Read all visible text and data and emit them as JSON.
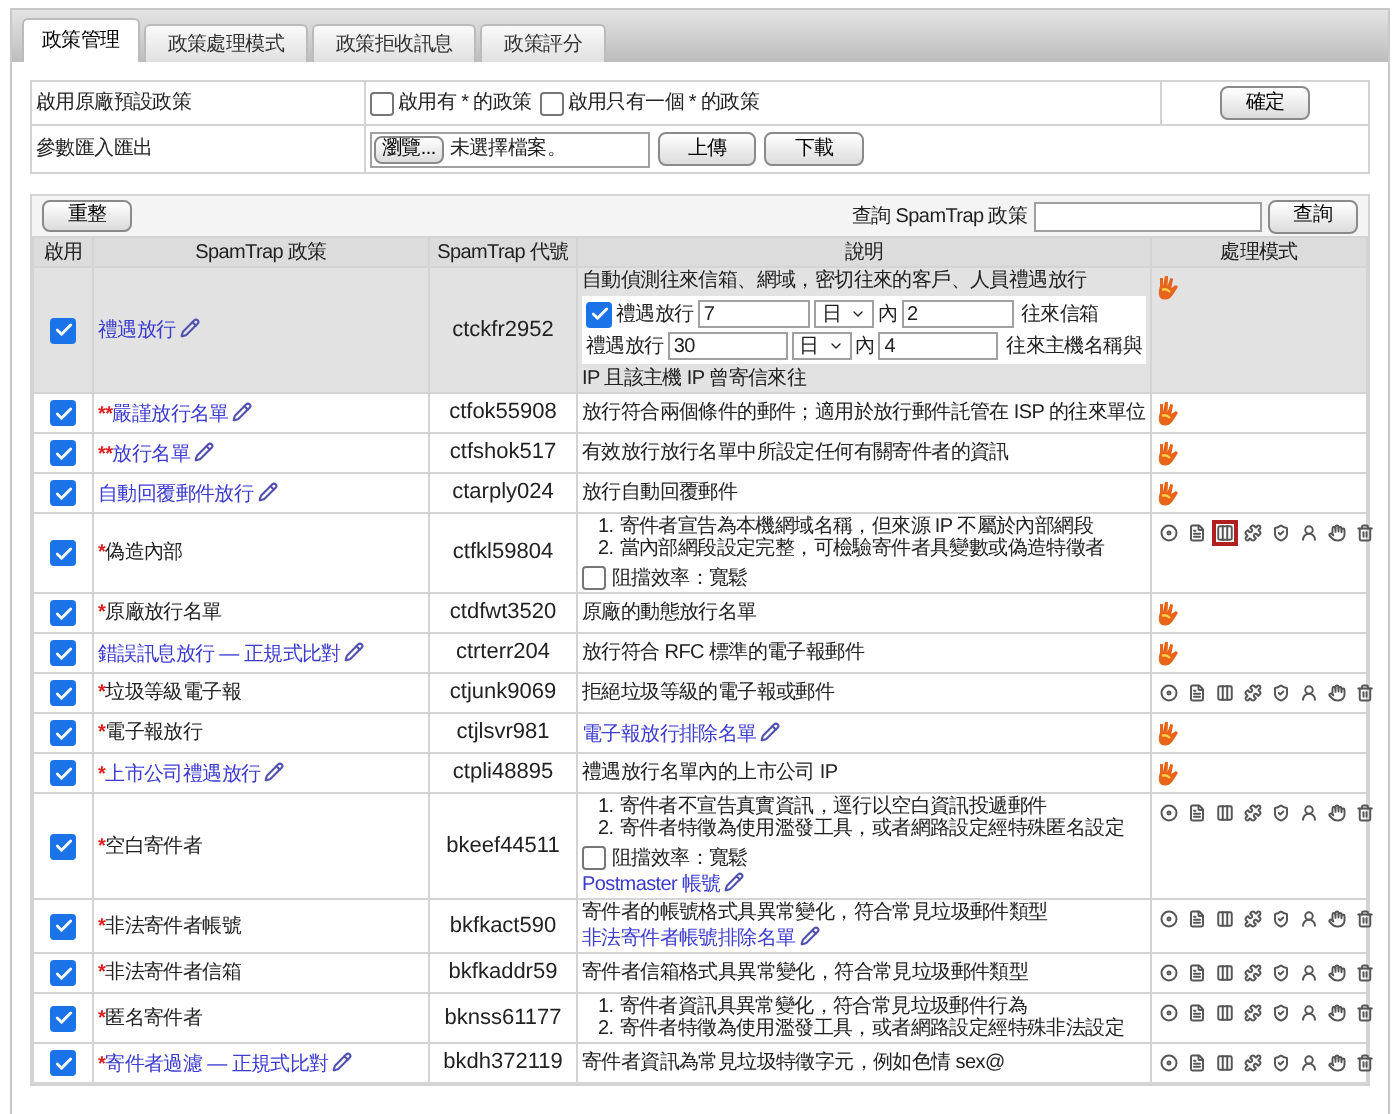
{
  "tabs": [
    {
      "label": "政策管理",
      "selected": true
    },
    {
      "label": "政策處理模式",
      "selected": false
    },
    {
      "label": "政策拒收訊息",
      "selected": false
    },
    {
      "label": "政策評分",
      "selected": false
    }
  ],
  "settings": {
    "defaults": {
      "label": "啟用原廠預設政策",
      "options": [
        {
          "label": "啟用有 * 的政策",
          "checked": false
        },
        {
          "label": "啟用只有一個 * 的政策",
          "checked": false
        }
      ],
      "button": "確定"
    },
    "import_export": {
      "label": "參數匯入匯出",
      "browse": "瀏覽...",
      "file": "未選擇檔案。",
      "upload": "上傳",
      "download": "下載"
    }
  },
  "toolbar": {
    "refresh": "重整",
    "search_label": "查詢 SpamTrap 政策",
    "search_button": "查詢"
  },
  "table": {
    "columns": [
      "啟用",
      "SpamTrap 政策",
      "SpamTrap 代號",
      "說明",
      "處理模式"
    ],
    "rows": [
      {
        "selected": true,
        "enabled": true,
        "name": "禮遇放行",
        "link": true,
        "code": "ctckfr2952",
        "desc": [
          {
            "kind": "form",
            "text": "自動偵測往來信箱、網域，密切往來的客戶、人員禮遇放行",
            "lines": [
              {
                "checkbox": {
                  "checked": true
                },
                "label": "禮遇放行",
                "value": "7",
                "unit": "日",
                "within": "內",
                "count": "2",
                "tail": "往來信箱"
              },
              {
                "label": "禮遇放行",
                "value": "30",
                "unit": "日",
                "within": "內",
                "count": "4",
                "tail": "往來主機名稱與"
              }
            ],
            "footer": "IP 且該主機 IP 曾寄信來往"
          }
        ],
        "mode": {
          "kind": "pass"
        }
      },
      {
        "selected": false,
        "enabled": true,
        "mark": "**",
        "name": "嚴謹放行名單",
        "link": true,
        "code": "ctfok55908",
        "desc": [
          {
            "kind": "text",
            "text": "放行符合兩個條件的郵件；適用於放行郵件託管在 ISP 的往來單位"
          }
        ],
        "mode": {
          "kind": "pass"
        }
      },
      {
        "selected": false,
        "enabled": true,
        "mark": "**",
        "name": "放行名單",
        "link": true,
        "code": "ctfshok517",
        "desc": [
          {
            "kind": "text",
            "text": "有效放行放行名單中所設定任何有關寄件者的資訊"
          }
        ],
        "mode": {
          "kind": "pass"
        }
      },
      {
        "selected": false,
        "enabled": true,
        "name": "自動回覆郵件放行",
        "link": true,
        "code": "ctarply024",
        "desc": [
          {
            "kind": "text",
            "text": "放行自動回覆郵件"
          }
        ],
        "mode": {
          "kind": "pass"
        }
      },
      {
        "selected": false,
        "enabled": true,
        "mark": "*",
        "name": "偽造內部",
        "link": false,
        "code": "ctfkl59804",
        "desc": [
          {
            "kind": "list",
            "items": [
              {
                "num": "1.",
                "text": "寄件者宣告為本機網域名稱，但來源 IP 不屬於內部網段"
              },
              {
                "num": "2.",
                "text": "當內部網段設定完整，可檢驗寄件者具變數或偽造特徵者"
              }
            ]
          },
          {
            "kind": "option",
            "label": "阻擋效率：寬鬆",
            "checked": false
          }
        ],
        "mode": {
          "kind": "actions",
          "actions": [
            {
              "selected": false
            },
            {
              "selected": false
            },
            {
              "selected": true
            },
            {
              "selected": false
            },
            {
              "selected": false
            },
            {
              "selected": false
            },
            {
              "selected": false
            },
            {
              "selected": false
            }
          ]
        }
      },
      {
        "selected": false,
        "enabled": true,
        "mark": "*",
        "name": "原廠放行名單",
        "link": false,
        "code": "ctdfwt3520",
        "desc": [
          {
            "kind": "text",
            "text": "原廠的動態放行名單"
          }
        ],
        "mode": {
          "kind": "pass"
        }
      },
      {
        "selected": false,
        "enabled": true,
        "name": "錯誤訊息放行 — 正規式比對",
        "link": true,
        "code": "ctrterr204",
        "desc": [
          {
            "kind": "text",
            "text": "放行符合 RFC 標準的電子報郵件"
          }
        ],
        "mode": {
          "kind": "pass"
        }
      },
      {
        "selected": false,
        "enabled": true,
        "mark": "*",
        "name": "垃圾等級電子報",
        "link": false,
        "code": "ctjunk9069",
        "desc": [
          {
            "kind": "text",
            "text": "拒絕垃圾等級的電子報或郵件"
          }
        ],
        "mode": {
          "kind": "actions",
          "actions": [
            {
              "selected": false
            },
            {
              "selected": false
            },
            {
              "selected": false
            },
            {
              "selected": false
            },
            {
              "selected": false
            },
            {
              "selected": false
            },
            {
              "selected": false
            },
            {
              "selected": false
            }
          ]
        }
      },
      {
        "selected": false,
        "enabled": true,
        "mark": "*",
        "name": "電子報放行",
        "link": false,
        "code": "ctjlsvr981",
        "desc": [
          {
            "kind": "link",
            "text": "電子報放行排除名單"
          }
        ],
        "mode": {
          "kind": "pass"
        }
      },
      {
        "selected": false,
        "enabled": true,
        "mark": "*",
        "name": "上市公司禮遇放行",
        "link": true,
        "code": "ctpli48895",
        "desc": [
          {
            "kind": "text",
            "text": "禮遇放行名單內的上市公司 IP"
          }
        ],
        "mode": {
          "kind": "pass"
        }
      },
      {
        "selected": false,
        "enabled": true,
        "mark": "*",
        "name": "空白寄件者",
        "link": false,
        "code": "bkeef44511",
        "desc": [
          {
            "kind": "list",
            "items": [
              {
                "num": "1.",
                "text": "寄件者不宣告真實資訊，逕行以空白資訊投遞郵件"
              },
              {
                "num": "2.",
                "text": "寄件者特徵為使用濫發工具，或者網路設定經特殊匿名設定"
              }
            ]
          },
          {
            "kind": "option",
            "label": "阻擋效率：寬鬆",
            "checked": false
          },
          {
            "kind": "link",
            "text": "Postmaster 帳號"
          }
        ],
        "mode": {
          "kind": "actions",
          "actions": [
            {
              "selected": false
            },
            {
              "selected": false
            },
            {
              "selected": false
            },
            {
              "selected": false
            },
            {
              "selected": false
            },
            {
              "selected": false
            },
            {
              "selected": false
            },
            {
              "selected": false
            }
          ]
        }
      },
      {
        "selected": false,
        "enabled": true,
        "mark": "*",
        "name": "非法寄件者帳號",
        "link": false,
        "code": "bkfkact590",
        "desc": [
          {
            "kind": "text",
            "text": "寄件者的帳號格式具異常變化，符合常見垃圾郵件類型"
          },
          {
            "kind": "link",
            "text": "非法寄件者帳號排除名單"
          }
        ],
        "mode": {
          "kind": "actions",
          "actions": [
            {
              "selected": false
            },
            {
              "selected": false
            },
            {
              "selected": false
            },
            {
              "selected": false
            },
            {
              "selected": false
            },
            {
              "selected": false
            },
            {
              "selected": false
            },
            {
              "selected": false
            }
          ]
        }
      },
      {
        "selected": false,
        "enabled": true,
        "mark": "*",
        "name": "非法寄件者信箱",
        "link": false,
        "code": "bkfkaddr59",
        "desc": [
          {
            "kind": "text",
            "text": "寄件者信箱格式具異常變化，符合常見垃圾郵件類型"
          }
        ],
        "mode": {
          "kind": "actions",
          "actions": [
            {
              "selected": false
            },
            {
              "selected": false
            },
            {
              "selected": false
            },
            {
              "selected": false
            },
            {
              "selected": false
            },
            {
              "selected": false
            },
            {
              "selected": false
            },
            {
              "selected": false
            }
          ]
        }
      },
      {
        "selected": false,
        "enabled": true,
        "mark": "*",
        "name": "匿名寄件者",
        "link": false,
        "code": "bknss61177",
        "desc": [
          {
            "kind": "list",
            "items": [
              {
                "num": "1.",
                "text": "寄件者資訊具異常變化，符合常見垃圾郵件行為"
              },
              {
                "num": "2.",
                "text": "寄件者特徵為使用濫發工具，或者網路設定經特殊非法設定"
              }
            ]
          }
        ],
        "mode": {
          "kind": "actions",
          "actions": [
            {
              "selected": false
            },
            {
              "selected": false
            },
            {
              "selected": false
            },
            {
              "selected": false
            },
            {
              "selected": false
            },
            {
              "selected": false
            },
            {
              "selected": false
            },
            {
              "selected": false
            }
          ]
        }
      },
      {
        "selected": false,
        "enabled": true,
        "mark": "*",
        "name": "寄件者過濾 — 正規式比對",
        "link": true,
        "code": "bkdh372119",
        "desc": [
          {
            "kind": "text",
            "text": "寄件者資訊為常見垃圾特徵字元，例如色情 sex@"
          }
        ],
        "mode": {
          "kind": "actions",
          "actions": [
            {
              "selected": false
            },
            {
              "selected": false
            },
            {
              "selected": false
            },
            {
              "selected": false
            },
            {
              "selected": false
            },
            {
              "selected": false
            },
            {
              "selected": false
            },
            {
              "selected": false
            }
          ]
        }
      }
    ]
  }
}
